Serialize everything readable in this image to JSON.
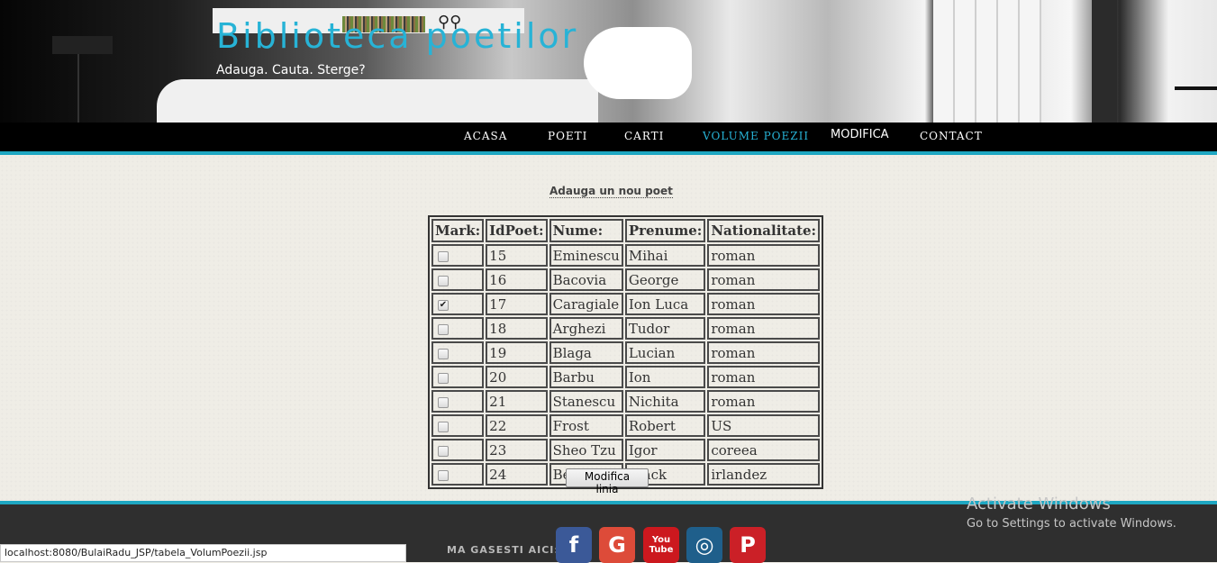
{
  "header": {
    "title": "Biblioteca poetilor",
    "tagline": "Adauga. Cauta. Sterge?"
  },
  "nav": {
    "items": [
      {
        "label": "ACASA"
      },
      {
        "label": "POETI"
      },
      {
        "label": "CARTI"
      },
      {
        "label": "VOLUME POEZII",
        "active": true
      },
      {
        "label": "MODIFICA"
      },
      {
        "label": "CONTACT"
      }
    ]
  },
  "main": {
    "add_link": "Adauga un nou poet",
    "table": {
      "columns": [
        "Mark:",
        "IdPoet:",
        "Nume:",
        "Prenume:",
        "Nationalitate:"
      ],
      "rows": [
        {
          "checked": false,
          "id": "15",
          "nume": "Eminescu",
          "prenume": "Mihai",
          "nationalitate": "roman"
        },
        {
          "checked": false,
          "id": "16",
          "nume": "Bacovia",
          "prenume": "George",
          "nationalitate": "roman"
        },
        {
          "checked": true,
          "id": "17",
          "nume": "Caragiale",
          "prenume": "Ion Luca",
          "nationalitate": "roman"
        },
        {
          "checked": false,
          "id": "18",
          "nume": "Arghezi",
          "prenume": "Tudor",
          "nationalitate": "roman"
        },
        {
          "checked": false,
          "id": "19",
          "nume": "Blaga",
          "prenume": "Lucian",
          "nationalitate": "roman"
        },
        {
          "checked": false,
          "id": "20",
          "nume": "Barbu",
          "prenume": "Ion",
          "nationalitate": "roman"
        },
        {
          "checked": false,
          "id": "21",
          "nume": "Stanescu",
          "prenume": "Nichita",
          "nationalitate": "roman"
        },
        {
          "checked": false,
          "id": "22",
          "nume": "Frost",
          "prenume": "Robert",
          "nationalitate": "US"
        },
        {
          "checked": false,
          "id": "23",
          "nume": "Sheo Tzu",
          "prenume": "Igor",
          "nationalitate": "coreea"
        },
        {
          "checked": false,
          "id": "24",
          "nume": "Benjamin",
          "prenume": "Black",
          "nationalitate": "irlandez"
        }
      ]
    },
    "submit_label": "Modifica linia"
  },
  "footer": {
    "find_us": "MA GASESTI AICI:",
    "social": [
      {
        "name": "facebook-icon",
        "glyph": "f"
      },
      {
        "name": "google-plus-icon",
        "glyph": "G"
      },
      {
        "name": "youtube-icon",
        "glyph_top": "You",
        "glyph_bottom": "Tube"
      },
      {
        "name": "instagram-icon",
        "glyph": "◎"
      },
      {
        "name": "pinterest-icon",
        "glyph": "P"
      }
    ]
  },
  "watermark": {
    "title": "Activate Windows",
    "subtitle": "Go to Settings to activate Windows."
  },
  "status_bar": {
    "url": "localhost:8080/BulaiRadu_JSP/tabela_VolumPoezii.jsp"
  },
  "colors": {
    "accent": "#1ea7c2",
    "title": "#27b3d6",
    "nav_bg": "#000000",
    "footer_bg": "#2f2f2f",
    "page_bg": "#efede6"
  }
}
